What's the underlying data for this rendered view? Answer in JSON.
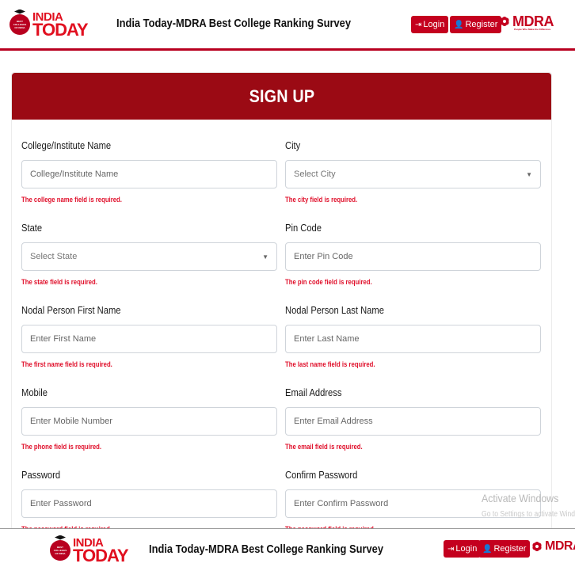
{
  "header": {
    "logo": {
      "badge": "BEST COLLEGES OF INDIA",
      "line1": "INDIA",
      "line2": "TODAY"
    },
    "title": "India Today-MDRA Best College Ranking Survey",
    "login_label": "Login",
    "register_label": "Register",
    "mdra": {
      "name": "MDRA",
      "tagline": "People Who Make the Difference"
    }
  },
  "form": {
    "heading": "SIGN UP",
    "fields": [
      {
        "label": "College/Institute Name",
        "placeholder": "College/Institute Name",
        "error": "The college name field is required."
      },
      {
        "label": "City",
        "selected": "Select City",
        "error": "The city field is required."
      },
      {
        "label": "State",
        "selected": "Select State",
        "error": "The state field is required."
      },
      {
        "label": "Pin Code",
        "placeholder": "Enter Pin Code",
        "error": "The pin code field is required."
      },
      {
        "label": "Nodal Person First Name",
        "placeholder": "Enter First Name",
        "error": "The first name field is required."
      },
      {
        "label": "Nodal Person Last Name",
        "placeholder": "Enter Last Name",
        "error": "The last name field is required."
      },
      {
        "label": "Mobile",
        "placeholder": "Enter Mobile Number",
        "error": "The phone field is required."
      },
      {
        "label": "Email Address",
        "placeholder": "Enter Email Address",
        "error": "The email field is required."
      },
      {
        "label": "Password",
        "placeholder": "Enter Password",
        "error": "The password field is required."
      },
      {
        "label": "Confirm Password",
        "placeholder": "Enter Confirm Password",
        "error": "The password field is required."
      }
    ]
  },
  "watermark": {
    "line1": "Activate Windows",
    "line2": "Go to Settings to activate Windows."
  },
  "colors": {
    "brand_red": "#9b0a14",
    "button_red": "#c4001e",
    "error_red": "#e0102b"
  },
  "icons": [
    "login-icon",
    "add-user-icon",
    "chevron-down-icon"
  ]
}
